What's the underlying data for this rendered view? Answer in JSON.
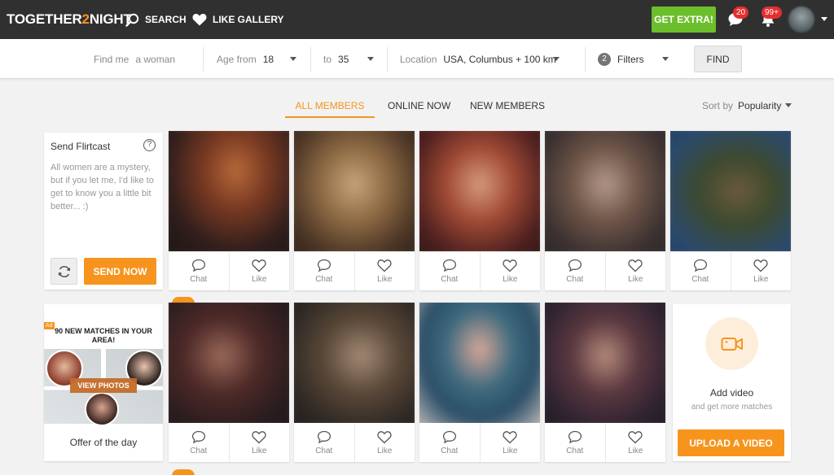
{
  "header": {
    "logo_part1": "TOGETHER",
    "logo_part2": "2",
    "logo_part3": "NIGHT",
    "search_label": "SEARCH",
    "like_gallery_label": "LIKE GALLERY",
    "get_extra_label": "GET EXTRA!",
    "messages_badge": "20",
    "notifications_badge": "99+"
  },
  "filters": {
    "find_me_label": "Find me",
    "find_me_value": "a woman",
    "age_from_label": "Age from",
    "age_from_value": "18",
    "age_to_label": "to",
    "age_to_value": "35",
    "location_label": "Location",
    "location_value": "USA, Columbus + 100 km",
    "filters_count": "2",
    "filters_label": "Filters",
    "find_button": "FIND"
  },
  "tabs": [
    {
      "label": "ALL MEMBERS",
      "active": true
    },
    {
      "label": "ONLINE NOW",
      "active": false
    },
    {
      "label": "NEW MEMBERS",
      "active": false
    }
  ],
  "sort": {
    "label": "Sort by",
    "value": "Popularity"
  },
  "flirtcast": {
    "title": "Send Flirtcast",
    "help": "?",
    "message": "All women are a mystery, but if you let me, I'd like to get to know you a little bit better... :)",
    "send_button": "SEND NOW"
  },
  "actions": {
    "chat": "Chat",
    "like": "Like"
  },
  "ad": {
    "tag": "Ad",
    "title": "90 NEW MATCHES IN YOUR AREA!",
    "view_photos": "VIEW PHOTOS",
    "offer": "Offer of the day"
  },
  "upload": {
    "title": "Add video",
    "subtitle": "and get more matches",
    "button": "UPLOAD A VIDEO"
  },
  "colors": {
    "accent": "#f7941d",
    "extra_green": "#6cbf2c",
    "badge_red": "#e62e2e",
    "topbar": "#303030"
  }
}
